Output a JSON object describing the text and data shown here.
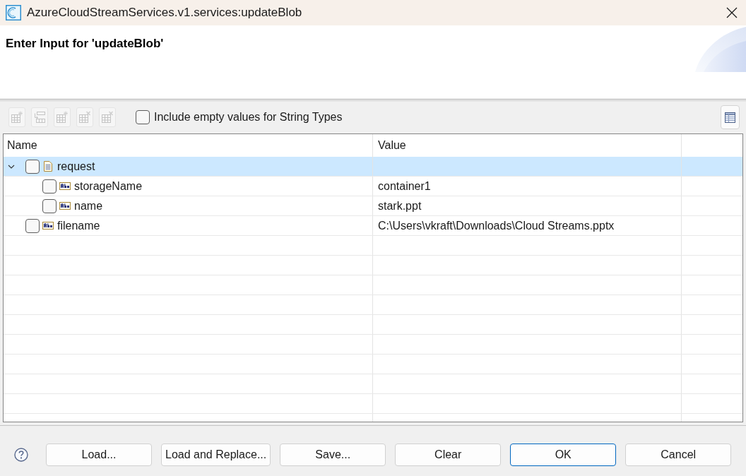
{
  "window": {
    "title": "AzureCloudStreamServices.v1.services:updateBlob"
  },
  "header": {
    "title": "Enter Input for 'updateBlob'"
  },
  "toolbar": {
    "tools": [
      {
        "kind": "sparkle",
        "disabled": true
      },
      {
        "kind": "arrow",
        "disabled": true
      },
      {
        "kind": "sparkle",
        "disabled": true
      },
      {
        "kind": "cross",
        "disabled": true
      },
      {
        "kind": "cross",
        "disabled": true
      }
    ],
    "include_empty": {
      "label": "Include empty values for String Types",
      "checked": false
    }
  },
  "table": {
    "columns": [
      "Name",
      "Value"
    ],
    "rows": [
      {
        "name": "request",
        "kind": "document",
        "checked": false,
        "selected": true,
        "expanded": true,
        "children": [
          {
            "name": "storageName",
            "kind": "string",
            "checked": false,
            "selected": false,
            "value": "container1"
          },
          {
            "name": "name",
            "kind": "string",
            "checked": false,
            "selected": false,
            "value": "stark.ppt"
          }
        ]
      },
      {
        "name": "filename",
        "kind": "string",
        "checked": false,
        "selected": false,
        "value": "C:\\Users\\vkraft\\Downloads\\Cloud Streams.pptx"
      }
    ]
  },
  "footer": {
    "buttons": [
      {
        "label": "Load...",
        "default": false
      },
      {
        "label": "Load and Replace...",
        "default": false
      },
      {
        "label": "Save...",
        "default": false
      },
      {
        "label": "Clear",
        "default": false
      },
      {
        "label": "OK",
        "default": true
      },
      {
        "label": "Cancel",
        "default": false
      }
    ]
  }
}
